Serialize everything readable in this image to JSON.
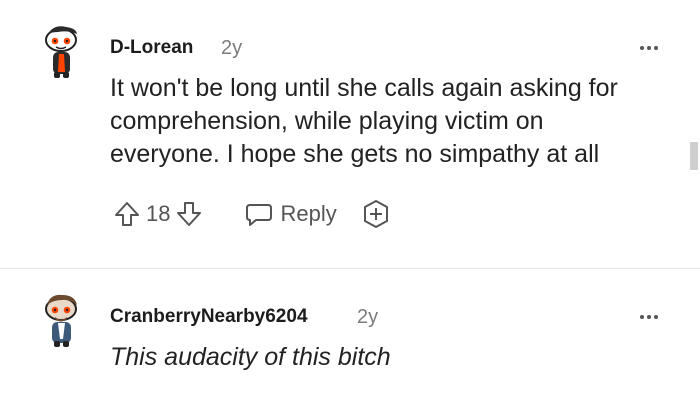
{
  "comments": [
    {
      "username": "D-Lorean",
      "age": "2y",
      "body_lines": [
        "It won't be long until she calls again asking for",
        "comprehension, while playing victim on",
        "everyone. I hope she gets no simpathy at all"
      ],
      "votes": "18",
      "reply_label": "Reply",
      "avatar_icon": "snoo-avatar-icon"
    },
    {
      "username": "CranberryNearby6204",
      "age": "2y",
      "body_lines": [
        "This audacity of this bitch"
      ],
      "avatar_icon": "snoo-avatar-icon"
    }
  ],
  "icons": {
    "upvote": "upvote-arrow-icon",
    "downvote": "downvote-arrow-icon",
    "reply": "speech-bubble-icon",
    "award": "award-plus-icon",
    "more": "more-options-icon"
  },
  "colors": {
    "text": "#1c1c1c",
    "meta": "#7c7c7c",
    "icon": "#555555",
    "avatar_accent": "#ff4500"
  }
}
